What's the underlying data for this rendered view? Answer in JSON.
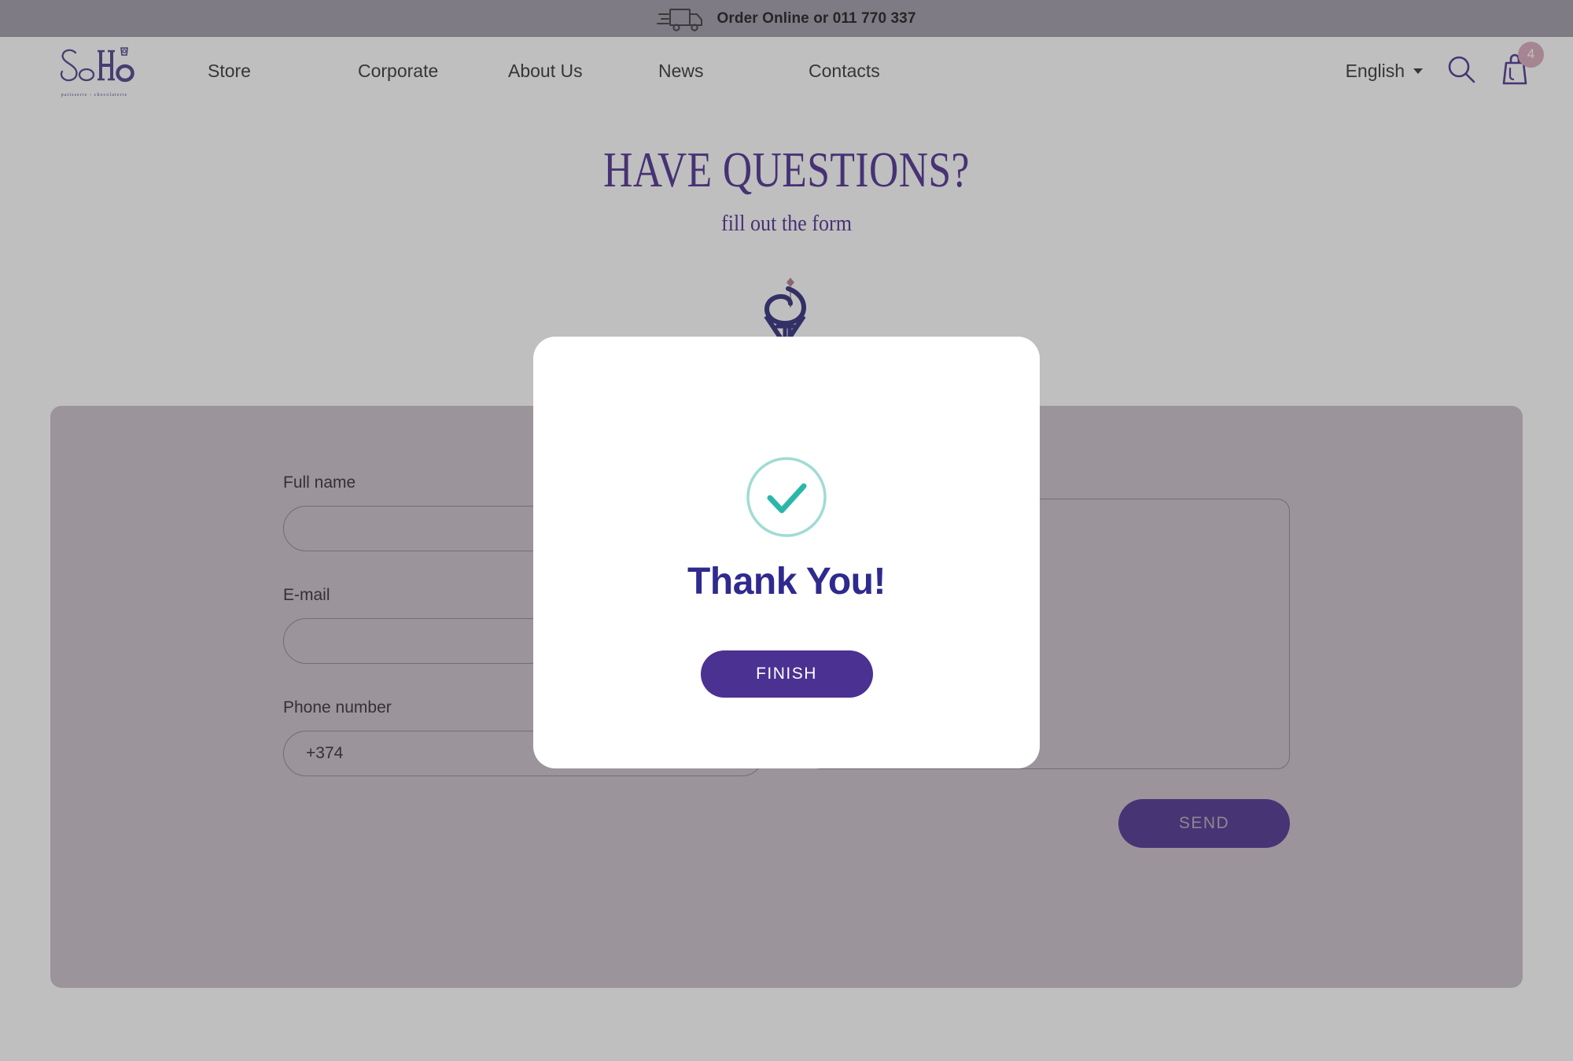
{
  "topbar": {
    "icon": "delivery-truck-icon",
    "text": "Order Online or 011 770 337"
  },
  "header": {
    "logo": {
      "name": "SoHo",
      "tagline": "patisserie - chocolaterie"
    },
    "nav": [
      {
        "label": "Store"
      },
      {
        "label": "Corporate"
      },
      {
        "label": "About Us"
      },
      {
        "label": "News"
      },
      {
        "label": "Contacts"
      }
    ],
    "language": {
      "selected": "English",
      "caret": "chevron-down-icon"
    },
    "search_icon": "search-icon",
    "cart": {
      "icon": "shopping-bag-icon",
      "badge_count": "4",
      "badge_color": "#d9a9bb"
    }
  },
  "hero": {
    "title": "HAVE QUESTIONS?",
    "subtitle": "fill out the form",
    "emblem": "soho-monogram-emblem",
    "accent_color": "#4b2d8f"
  },
  "form": {
    "fields": [
      {
        "label": "Full name",
        "value": "",
        "placeholder": ""
      },
      {
        "label": "E-mail",
        "value": "",
        "placeholder": ""
      },
      {
        "label": "Phone number",
        "value": "+374",
        "placeholder": "+374"
      }
    ],
    "message": {
      "value": "",
      "placeholder": ""
    },
    "send_label": "SEND",
    "panel_color": "#cbbfc9",
    "button_color": "#4b3191"
  },
  "modal": {
    "check_icon": "check-circle-icon",
    "check_color": "#2ab7a9",
    "title": "Thank You!",
    "title_color": "#2f2a8e",
    "finish_label": "FINISH",
    "button_color": "#4b3191"
  }
}
